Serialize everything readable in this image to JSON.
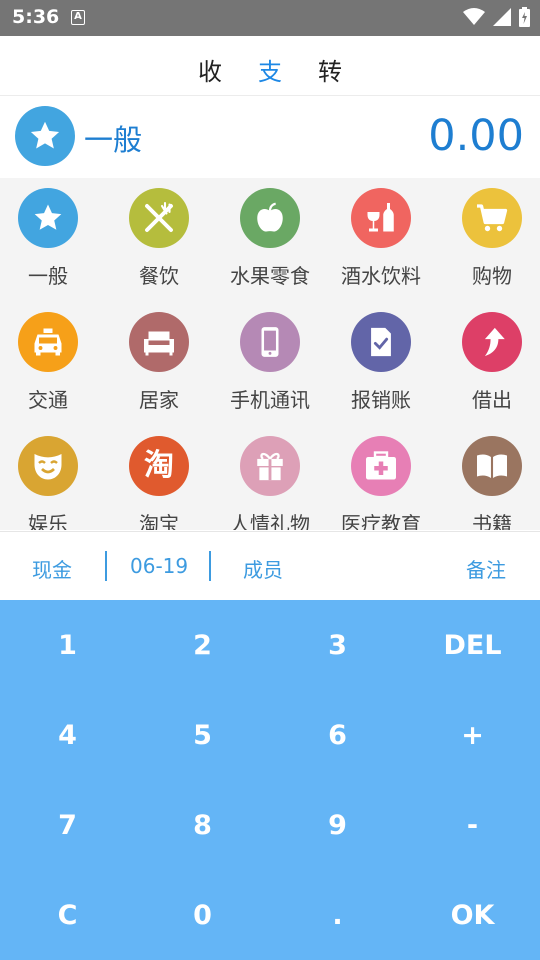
{
  "status_bar": {
    "time": "5:36",
    "notification_letter": "A"
  },
  "tabs": [
    {
      "label": "收",
      "active": false
    },
    {
      "label": "支",
      "active": true
    },
    {
      "label": "转",
      "active": false
    }
  ],
  "selected": {
    "category": "一般",
    "amount": "0.00",
    "icon": "star-icon",
    "color": "#42a5e0"
  },
  "categories": [
    {
      "label": "一般",
      "icon": "star-icon",
      "color": "#42a5e0"
    },
    {
      "label": "餐饮",
      "icon": "fork-knife-icon",
      "color": "#b5bd3d"
    },
    {
      "label": "水果零食",
      "icon": "apple-icon",
      "color": "#6aa864"
    },
    {
      "label": "酒水饮料",
      "icon": "drink-bottle-icon",
      "color": "#f06560"
    },
    {
      "label": "购物",
      "icon": "shopping-cart-icon",
      "color": "#ecc23c"
    },
    {
      "label": "交通",
      "icon": "taxi-icon",
      "color": "#f6a019"
    },
    {
      "label": "居家",
      "icon": "sofa-icon",
      "color": "#b06a6a"
    },
    {
      "label": "手机通讯",
      "icon": "phone-icon",
      "color": "#b589b5"
    },
    {
      "label": "报销账",
      "icon": "checked-document-icon",
      "color": "#6265a8"
    },
    {
      "label": "借出",
      "icon": "arrow-up-icon",
      "color": "#dd3f67"
    },
    {
      "label": "娱乐",
      "icon": "mask-icon",
      "color": "#d9a532"
    },
    {
      "label": "淘宝",
      "icon": "taobao-icon",
      "color": "#e05a2e",
      "glyph": "淘"
    },
    {
      "label": "人情礼物",
      "icon": "gift-icon",
      "color": "#dda0b7"
    },
    {
      "label": "医疗教育",
      "icon": "medical-kit-icon",
      "color": "#e77fb5"
    },
    {
      "label": "书籍",
      "icon": "book-icon",
      "color": "#9a7560"
    }
  ],
  "info_bar": {
    "account": "现金",
    "date": "06-19",
    "member": "成员",
    "note": "备注"
  },
  "keypad": {
    "rows": [
      [
        "1",
        "2",
        "3",
        "DEL"
      ],
      [
        "4",
        "5",
        "6",
        "+"
      ],
      [
        "7",
        "8",
        "9",
        "-"
      ],
      [
        "C",
        "0",
        ".",
        "OK"
      ]
    ]
  },
  "colors": {
    "accent": "#1e88e5",
    "keypad": "#64b5f6",
    "status_bar": "#757575"
  }
}
